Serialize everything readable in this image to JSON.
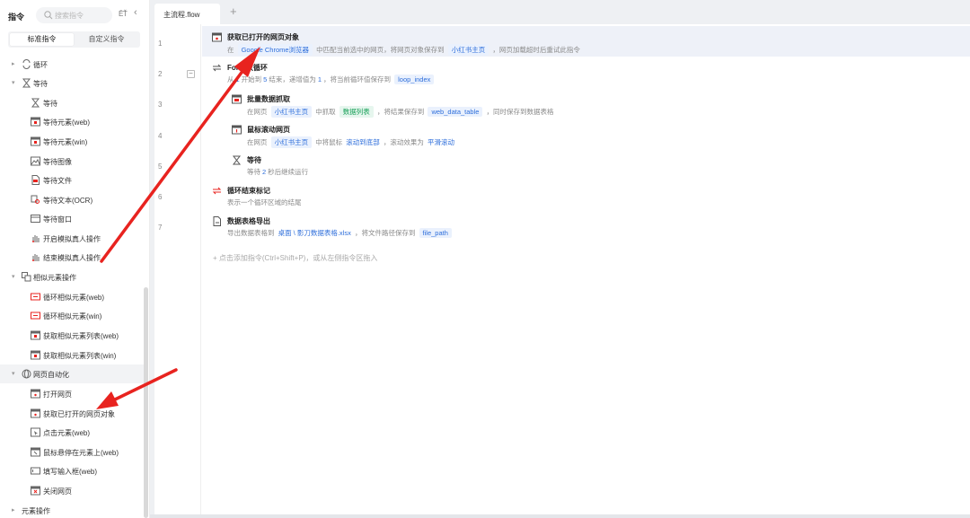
{
  "sidebar": {
    "title": "指令",
    "search_placeholder": "搜索指令",
    "sort_label": "ĒŤ",
    "collapse_icon": "‹",
    "tabs": [
      "标准指令",
      "自定义指令"
    ],
    "items": [
      {
        "label": "循环",
        "icon": "loop-icon",
        "level": 0,
        "arrow": "▸"
      },
      {
        "label": "等待",
        "icon": "hourglass-icon",
        "level": 0,
        "arrow": "▾"
      },
      {
        "label": "等待",
        "icon": "hourglass-icon",
        "level": 1
      },
      {
        "label": "等待元素(web)",
        "icon": "web-element-icon",
        "level": 1
      },
      {
        "label": "等待元素(win)",
        "icon": "win-element-icon",
        "level": 1
      },
      {
        "label": "等待图像",
        "icon": "image-icon",
        "level": 1
      },
      {
        "label": "等待文件",
        "icon": "file-icon",
        "level": 1
      },
      {
        "label": "等待文本(OCR)",
        "icon": "ocr-icon",
        "level": 1
      },
      {
        "label": "等待窗口",
        "icon": "window-icon",
        "level": 1
      },
      {
        "label": "开启模拟真人操作",
        "icon": "hand-icon",
        "level": 1
      },
      {
        "label": "结束模拟真人操作",
        "icon": "hand-stop-icon",
        "level": 1
      },
      {
        "label": "相似元素操作",
        "icon": "similar-icon",
        "level": 0,
        "arrow": "▾"
      },
      {
        "label": "循环相似元素(web)",
        "icon": "loop-similar-icon",
        "level": 1
      },
      {
        "label": "循环相似元素(win)",
        "icon": "loop-similar-icon",
        "level": 1
      },
      {
        "label": "获取相似元素列表(web)",
        "icon": "list-icon",
        "level": 1
      },
      {
        "label": "获取相似元素列表(win)",
        "icon": "list-icon",
        "level": 1
      },
      {
        "label": "网页自动化",
        "icon": "globe-icon",
        "level": 0,
        "arrow": "▾"
      },
      {
        "label": "打开网页",
        "icon": "browser-icon",
        "level": 1
      },
      {
        "label": "获取已打开的网页对象",
        "icon": "browser-icon",
        "level": 1
      },
      {
        "label": "点击元素(web)",
        "icon": "click-icon",
        "level": 1
      },
      {
        "label": "鼠标悬停在元素上(web)",
        "icon": "hover-icon",
        "level": 1
      },
      {
        "label": "填写输入框(web)",
        "icon": "input-icon",
        "level": 1
      },
      {
        "label": "关闭网页",
        "icon": "close-page-icon",
        "level": 1
      },
      {
        "label": "元素操作",
        "icon": "",
        "level": 0,
        "arrow": "▸"
      }
    ]
  },
  "tabs": {
    "active": "主流程.flow",
    "add": "+"
  },
  "editor": {
    "line_numbers": [
      "1",
      "2",
      "3",
      "4",
      "5",
      "6",
      "7"
    ],
    "fold": "−",
    "steps": {
      "s1": {
        "title": "获取已打开的网页对象",
        "d1": "在",
        "t1": "Google Chrome浏览器",
        "d2": "中匹配当前选中的网页，将网页对象保存到",
        "t2": "小红书主页",
        "d3": "，网页加载超时后重试此指令"
      },
      "s2": {
        "title": "For次数循环",
        "d1": "从",
        "n1": "1",
        "d2": "开始到",
        "n2": "5",
        "d3": "结束，递增值为",
        "n3": "1",
        "d4": "，将当前循环值保存到",
        "t1": "loop_index"
      },
      "s3": {
        "title": "批量数据抓取",
        "d1": "在网页",
        "t1": "小红书主页",
        "d2": "中抓取",
        "t2": "数据列表",
        "d3": "，将结果保存到",
        "t3": "web_data_table",
        "d4": "，同时保存到数据表格"
      },
      "s4": {
        "title": "鼠标滚动网页",
        "d1": "在网页",
        "t1": "小红书主页",
        "d2": "中将鼠标",
        "t2": "滚动到底部",
        "d3": "，滚动效果为",
        "t3": "平滑滚动"
      },
      "s5": {
        "title": "等待",
        "d1": "等待",
        "n1": "2",
        "d2": "秒后继续运行"
      },
      "s6": {
        "title": "循环结束标记",
        "d1": "表示一个循环区域的结尾"
      },
      "s7": {
        "title": "数据表格导出",
        "d1": "导出数据表格到",
        "t1": "桌面 \\ 影刀数据表格.xlsx",
        "d2": "，将文件路径保存到",
        "t2": "file_path"
      }
    },
    "add_hint": "+ 点击添加指令(Ctrl+Shift+P)，或从左侧指令区拖入"
  },
  "colors": {
    "accent": "#2f6fdb",
    "arrow_red": "#e8231f",
    "tag_green": "#18a058"
  }
}
